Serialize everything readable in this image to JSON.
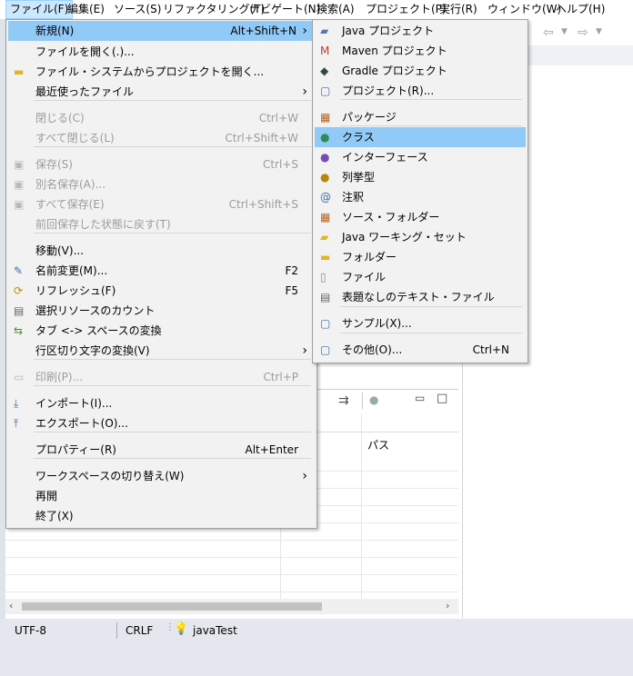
{
  "menubar": {
    "items": [
      {
        "label": "ファイル(F)",
        "active": true
      },
      {
        "label": "編集(E)"
      },
      {
        "label": "ソース(S)"
      },
      {
        "label": "リファクタリング(T)"
      },
      {
        "label": "ナビゲート(N)"
      },
      {
        "label": "検索(A)"
      },
      {
        "label": "プロジェクト(P)"
      },
      {
        "label": "実行(R)"
      },
      {
        "label": "ウィンドウ(W)"
      },
      {
        "label": "ヘルプ(H)"
      }
    ]
  },
  "file_menu": {
    "items": [
      {
        "label": "新規(N)",
        "shortcut": "Alt+Shift+N",
        "arrow": "›",
        "highlighted": true
      },
      {
        "label": "ファイルを開く(.)..."
      },
      {
        "label": "ファイル・システムからプロジェクトを開く...",
        "icon": "folder-icon"
      },
      {
        "label": "最近使ったファイル",
        "arrow": "›"
      },
      {
        "label": "閉じる(C)",
        "shortcut": "Ctrl+W",
        "disabled": true
      },
      {
        "label": "すべて閉じる(L)",
        "shortcut": "Ctrl+Shift+W",
        "disabled": true
      },
      {
        "label": "保存(S)",
        "shortcut": "Ctrl+S",
        "disabled": true,
        "icon": "save-icon"
      },
      {
        "label": "別名保存(A)...",
        "disabled": true,
        "icon": "save-as-icon"
      },
      {
        "label": "すべて保存(E)",
        "shortcut": "Ctrl+Shift+S",
        "disabled": true,
        "icon": "save-all-icon"
      },
      {
        "label": "前回保存した状態に戻す(T)",
        "disabled": true
      },
      {
        "label": "移動(V)..."
      },
      {
        "label": "名前変更(M)...",
        "shortcut": "F2",
        "icon": "rename-icon"
      },
      {
        "label": "リフレッシュ(F)",
        "shortcut": "F5",
        "icon": "refresh-icon"
      },
      {
        "label": "選択リソースのカウント",
        "icon": "count-icon"
      },
      {
        "label": "タブ <-> スペースの変換",
        "icon": "convert-icon"
      },
      {
        "label": "行区切り文字の変換(V)",
        "arrow": "›"
      },
      {
        "label": "印刷(P)...",
        "shortcut": "Ctrl+P",
        "disabled": true,
        "icon": "print-icon"
      },
      {
        "label": "インポート(I)...",
        "icon": "import-icon"
      },
      {
        "label": "エクスポート(O)...",
        "icon": "export-icon"
      },
      {
        "label": "プロパティー(R)",
        "shortcut": "Alt+Enter"
      },
      {
        "label": "ワークスペースの切り替え(W)",
        "arrow": "›"
      },
      {
        "label": "再開"
      },
      {
        "label": "終了(X)"
      }
    ]
  },
  "new_submenu": {
    "items": [
      {
        "label": "Java プロジェクト",
        "icon": "java-project-icon"
      },
      {
        "label": "Maven プロジェクト",
        "icon": "maven-project-icon"
      },
      {
        "label": "Gradle プロジェクト",
        "icon": "gradle-project-icon"
      },
      {
        "label": "プロジェクト(R)...",
        "icon": "project-icon"
      },
      {
        "label": "パッケージ",
        "icon": "package-icon"
      },
      {
        "label": "クラス",
        "icon": "class-icon",
        "highlighted": true
      },
      {
        "label": "インターフェース",
        "icon": "interface-icon"
      },
      {
        "label": "列挙型",
        "icon": "enum-icon"
      },
      {
        "label": "注釈",
        "icon": "annotation-icon"
      },
      {
        "label": "ソース・フォルダー",
        "icon": "source-folder-icon"
      },
      {
        "label": "Java ワーキング・セット",
        "icon": "working-set-icon"
      },
      {
        "label": "フォルダー",
        "icon": "folder-icon"
      },
      {
        "label": "ファイル",
        "icon": "file-icon"
      },
      {
        "label": "表題なしのテキスト・ファイル",
        "icon": "text-file-icon"
      },
      {
        "label": "サンプル(X)...",
        "icon": "sample-icon"
      },
      {
        "label": "その他(O)...",
        "shortcut": "Ctrl+N",
        "icon": "other-icon"
      }
    ]
  },
  "view": {
    "column_header": "パス"
  },
  "status": {
    "encoding": "UTF-8",
    "line_ending": "CRLF",
    "project": "javaTest"
  },
  "colors": {
    "highlight": "#91c9f7",
    "menubar_active": "#cce8ff",
    "status_bg": "#e4e8ee"
  }
}
